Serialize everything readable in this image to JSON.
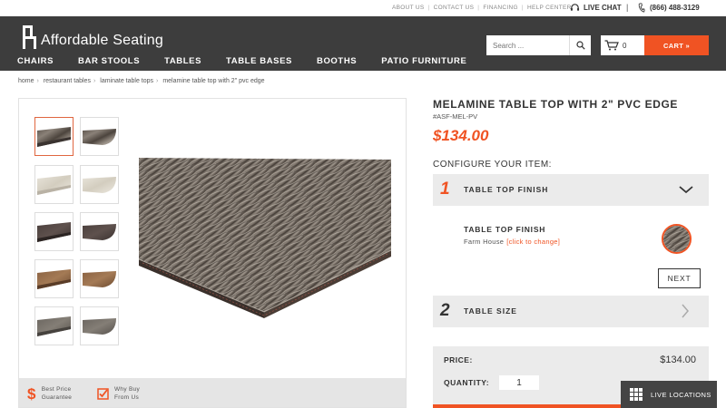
{
  "top_links": [
    "ABOUT US",
    "CONTACT US",
    "FINANCING",
    "HELP CENTER"
  ],
  "live_chat": "LIVE CHAT",
  "phone": "(866) 488-3129",
  "logo_text": "Affordable Seating",
  "search": {
    "placeholder": "Search ..."
  },
  "cart": {
    "count": "0",
    "button_label": "CART »"
  },
  "nav": [
    "CHAIRS",
    "BAR STOOLS",
    "TABLES",
    "TABLE BASES",
    "BOOTHS",
    "PATIO FURNITURE"
  ],
  "breadcrumb": [
    "home",
    "restaurant tables",
    "laminate table tops",
    "melamine table top with 2\" pvc edge"
  ],
  "product": {
    "title": "MELAMINE TABLE TOP WITH 2\" PVC EDGE",
    "sku": "#ASF-MEL-PV",
    "price": "$134.00"
  },
  "configure_label": "CONFIGURE YOUR ITEM:",
  "steps": [
    {
      "num": "1",
      "label": "TABLE TOP FINISH"
    },
    {
      "num": "2",
      "label": "TABLE SIZE"
    }
  ],
  "finish": {
    "label": "TABLE TOP FINISH",
    "value": "Farm House",
    "change": "[click to change]"
  },
  "next_label": "NEXT",
  "summary": {
    "price_label": "PRICE:",
    "price_value": "$134.00",
    "qty_label": "QUANTITY:",
    "qty_value": "1"
  },
  "badges": {
    "best_price_1": "Best Price",
    "best_price_2": "Guarantee",
    "why_buy_1": "Why Buy",
    "why_buy_2": "From Us"
  },
  "live_locations": "LIVE LOCATIONS",
  "colors": {
    "accent": "#f05323",
    "header_bg": "#3d3d3d",
    "panel_bg": "#ebebeb"
  }
}
